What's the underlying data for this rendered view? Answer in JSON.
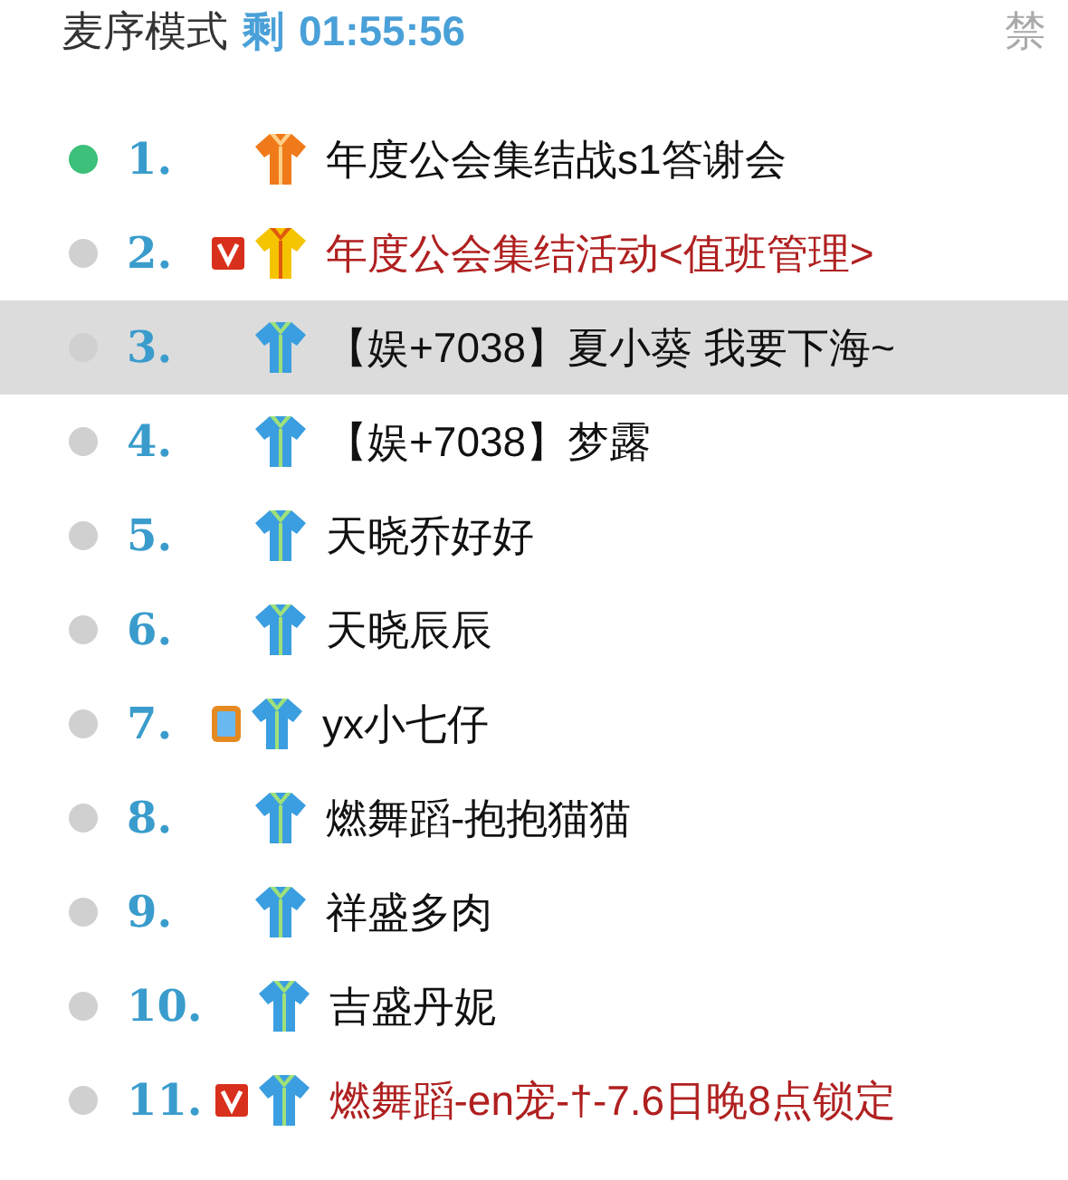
{
  "header": {
    "mode": "麦序模式",
    "remaining_label": "剩",
    "remaining_time": "01:55:56",
    "side_button": "禁"
  },
  "rows": [
    {
      "number": "1.",
      "online": true,
      "selected": false,
      "vest": {
        "kind": "orange"
      },
      "highlight": false,
      "name": "年度公会集结战s1答谢会"
    },
    {
      "number": "2.",
      "online": false,
      "selected": false,
      "badge": {
        "kind": "vip"
      },
      "vest": {
        "kind": "gold"
      },
      "highlight": true,
      "name": "年度公会集结活动<值班管理>"
    },
    {
      "number": "3.",
      "online": false,
      "selected": true,
      "vest": {
        "kind": "blue"
      },
      "highlight": false,
      "name": "【娱+7038】夏小葵  我要下海~"
    },
    {
      "number": "4.",
      "online": false,
      "selected": false,
      "vest": {
        "kind": "blue"
      },
      "highlight": false,
      "name": "【娱+7038】梦露"
    },
    {
      "number": "5.",
      "online": false,
      "selected": false,
      "vest": {
        "kind": "blue"
      },
      "highlight": false,
      "name": "天晓乔好好"
    },
    {
      "number": "6.",
      "online": false,
      "selected": false,
      "vest": {
        "kind": "blue"
      },
      "highlight": false,
      "name": "天晓辰辰"
    },
    {
      "number": "7.",
      "online": false,
      "selected": false,
      "badge": {
        "kind": "mobile"
      },
      "vest": {
        "kind": "blue"
      },
      "highlight": false,
      "name": "yx小七仔"
    },
    {
      "number": "8.",
      "online": false,
      "selected": false,
      "vest": {
        "kind": "blue"
      },
      "highlight": false,
      "name": "燃舞蹈-抱抱猫猫"
    },
    {
      "number": "9.",
      "online": false,
      "selected": false,
      "vest": {
        "kind": "blue"
      },
      "highlight": false,
      "name": "祥盛多肉"
    },
    {
      "number": "10.",
      "online": false,
      "selected": false,
      "vest": {
        "kind": "blue"
      },
      "highlight": false,
      "name": "吉盛丹妮"
    },
    {
      "number": "11.",
      "online": false,
      "selected": false,
      "badge": {
        "kind": "vip"
      },
      "vest": {
        "kind": "blue"
      },
      "highlight": true,
      "name": "燃舞蹈-en宠-†-7.6日晚8点锁定"
    }
  ]
}
